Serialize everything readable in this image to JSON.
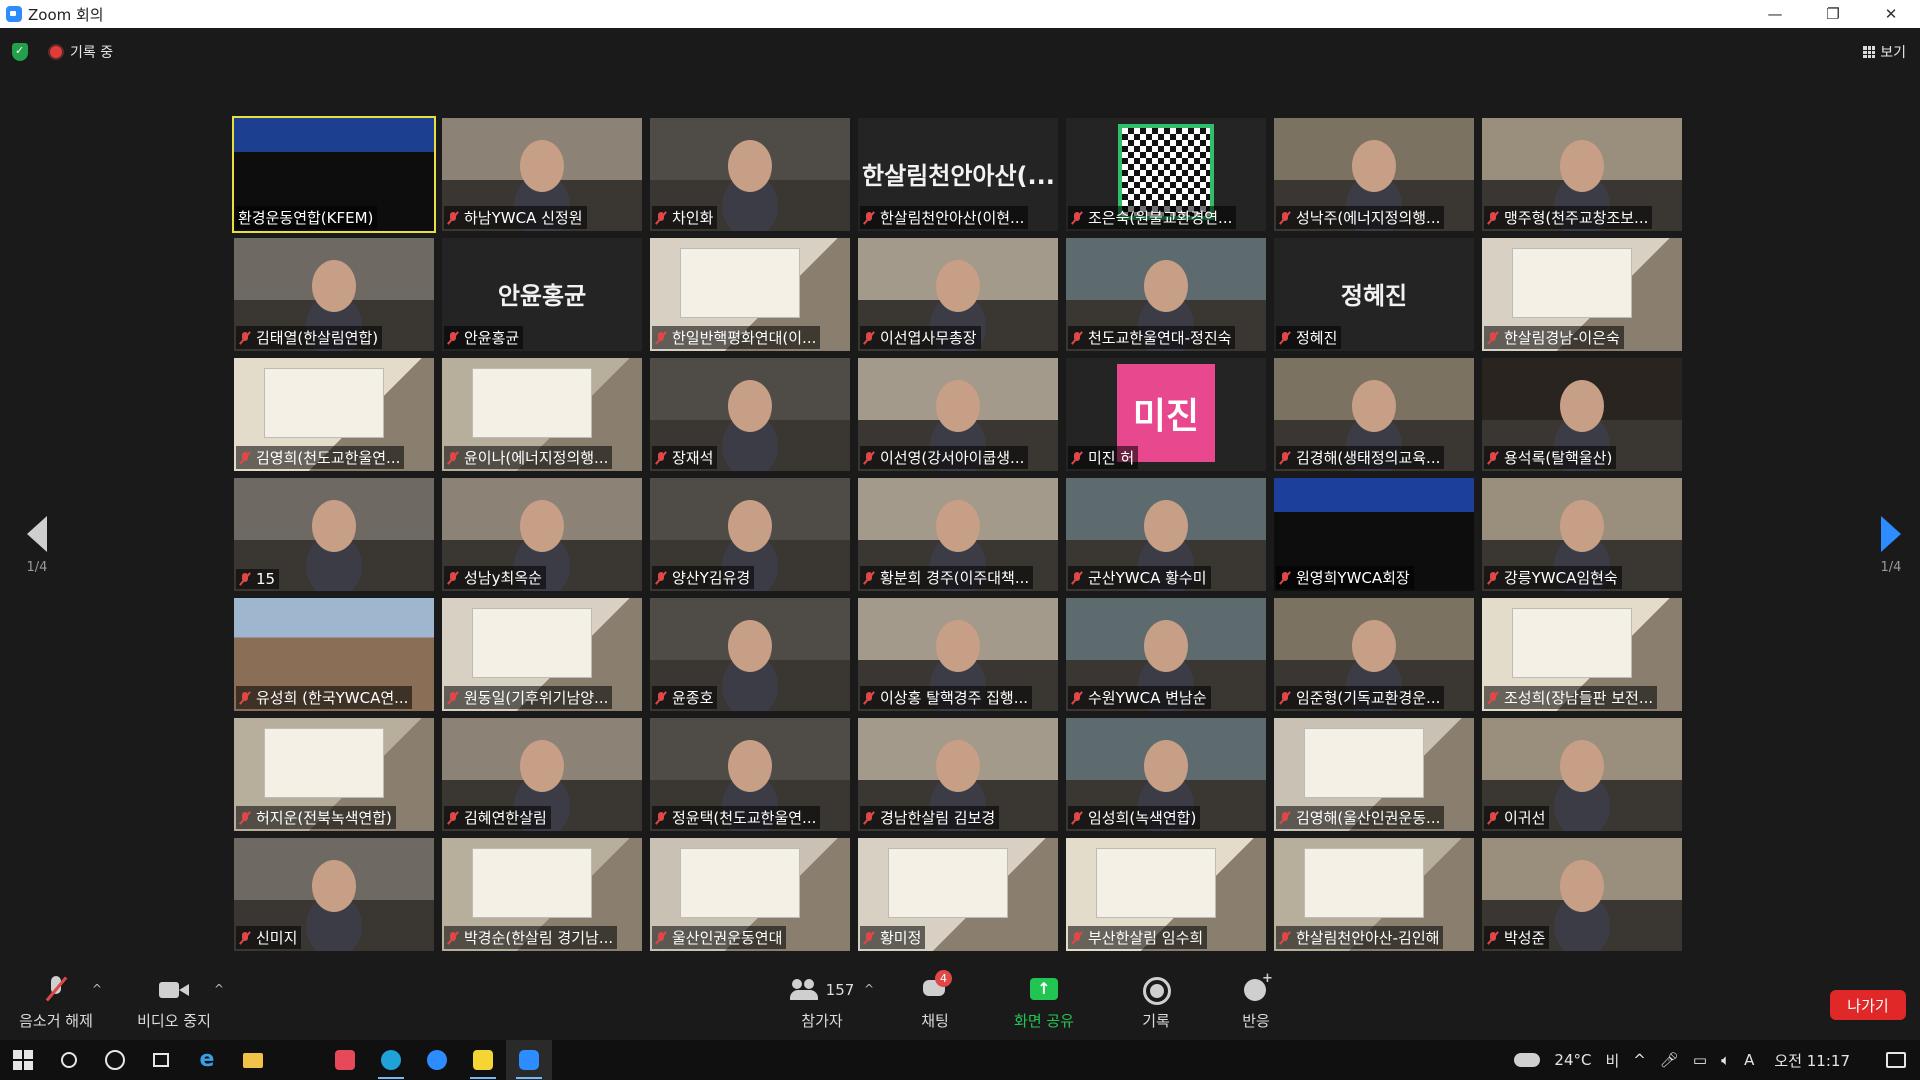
{
  "window": {
    "title": "Zoom 회의"
  },
  "top_status": {
    "recording_label": "기록 중",
    "view_label": "보기"
  },
  "pagination": {
    "left": "1/4",
    "right": "1/4"
  },
  "participants": [
    {
      "name": "환경운동연합(KFEM)",
      "video": "slide",
      "active": true
    },
    {
      "name": "하남YWCA 신정원",
      "video": "cam"
    },
    {
      "name": "차인화",
      "video": "cam"
    },
    {
      "name": "한살림천안아산(이현...",
      "video": "none",
      "display": "한살림천안아산(..."
    },
    {
      "name": "조은숙(원불교환경연...",
      "video": "qr"
    },
    {
      "name": "성낙주(에너지정의행...",
      "video": "cam"
    },
    {
      "name": "맹주형(천주교창조보...",
      "video": "cam"
    },
    {
      "name": "김태열(한살림연합)",
      "video": "cam"
    },
    {
      "name": "안윤홍균",
      "video": "none",
      "display": "안윤홍균"
    },
    {
      "name": "한일반핵평화연대(이...",
      "video": "sign"
    },
    {
      "name": "이선엽사무총장",
      "video": "cam"
    },
    {
      "name": "천도교한울연대-정진숙",
      "video": "cam"
    },
    {
      "name": "정혜진",
      "video": "none",
      "display": "정혜진"
    },
    {
      "name": "한살림경남-이은숙",
      "video": "sign"
    },
    {
      "name": "김영희(천도교한울연...",
      "video": "sign"
    },
    {
      "name": "윤이나(에너지정의행...",
      "video": "sign"
    },
    {
      "name": "장재석",
      "video": "cam"
    },
    {
      "name": "이선영(강서아이쿱생...",
      "video": "cam"
    },
    {
      "name": "미진 허",
      "video": "pink",
      "display": "미진"
    },
    {
      "name": "김경해(생태정의교육...",
      "video": "cam"
    },
    {
      "name": "용석록(탈핵울산)",
      "video": "dark"
    },
    {
      "name": "15",
      "video": "cam"
    },
    {
      "name": "성남y최옥순",
      "video": "cam"
    },
    {
      "name": "양산Y김유경",
      "video": "cam"
    },
    {
      "name": "황분희 경주(이주대책...",
      "video": "cam"
    },
    {
      "name": "군산YWCA 황수미",
      "video": "cam"
    },
    {
      "name": "원영희YWCA회장",
      "video": "slide2"
    },
    {
      "name": "강릉YWCA임현숙",
      "video": "cam"
    },
    {
      "name": "유성희 (한국YWCA연...",
      "video": "city"
    },
    {
      "name": "원동일(기후위기남양...",
      "video": "sign"
    },
    {
      "name": "윤종호",
      "video": "cam"
    },
    {
      "name": "이상홍 탈핵경주 집행...",
      "video": "cam"
    },
    {
      "name": "수원YWCA 변남순",
      "video": "cam"
    },
    {
      "name": "임준형(기독교환경운...",
      "video": "cam"
    },
    {
      "name": "조성희(장남들판 보전...",
      "video": "sign"
    },
    {
      "name": "허지운(전북녹색연합)",
      "video": "sign"
    },
    {
      "name": "김혜연한살림",
      "video": "cam"
    },
    {
      "name": "정윤택(천도교한울연...",
      "video": "cam"
    },
    {
      "name": "경남한살림 김보경",
      "video": "cam"
    },
    {
      "name": "임성희(녹색연합)",
      "video": "cam"
    },
    {
      "name": "김영해(울산인권운동...",
      "video": "sign"
    },
    {
      "name": "이귀선",
      "video": "cam"
    },
    {
      "name": "신미지",
      "video": "cam"
    },
    {
      "name": "박경순(한살림 경기남...",
      "video": "sign"
    },
    {
      "name": "울산인권운동연대",
      "video": "sign"
    },
    {
      "name": "황미정",
      "video": "sign"
    },
    {
      "name": "부산한살림 임수희",
      "video": "sign"
    },
    {
      "name": "한살림천안아산-김인해",
      "video": "sign"
    },
    {
      "name": "박성준",
      "video": "cam"
    }
  ],
  "toolbar": {
    "mute_label": "음소거 해제",
    "video_label": "비디오 중지",
    "participants_count": "157",
    "participants_label": "참가자",
    "chat_label": "채팅",
    "chat_badge": "4",
    "share_label": "화면 공유",
    "record_label": "기록",
    "reactions_label": "반응",
    "leave_label": "나가기"
  },
  "taskbar": {
    "temperature": "24°C",
    "weather": "비",
    "ime": "A",
    "time": "오전 11:17"
  },
  "colors": {
    "background": "#1a1a1a",
    "tile": "#242424",
    "active_speaker": "#e8e043",
    "share_green": "#23c552",
    "leave_red": "#e02828",
    "mute_red": "#e04848",
    "next_arrow": "#2d8cff"
  }
}
